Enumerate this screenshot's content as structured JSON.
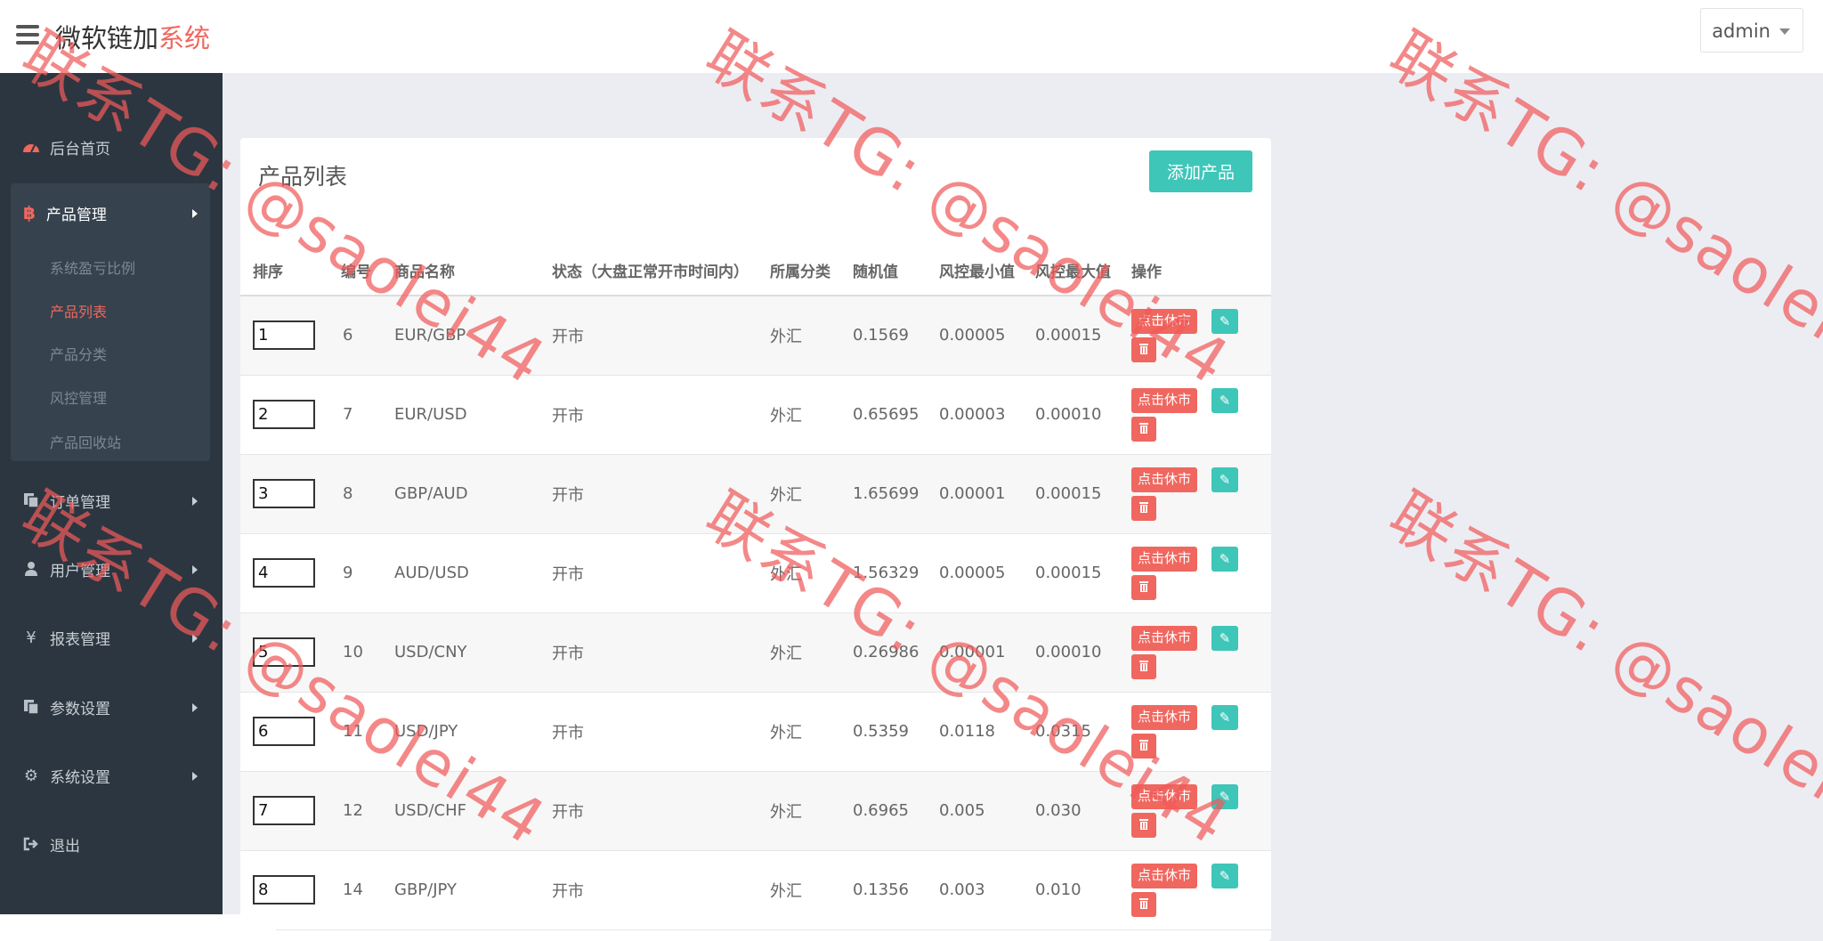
{
  "app": {
    "brand_main": "微软链加",
    "brand_accent": "系统",
    "user": "admin"
  },
  "sidebar": {
    "dashboard": "后台首页",
    "product_group": {
      "label": "产品管理",
      "items": [
        "系统盈亏比例",
        "产品列表",
        "产品分类",
        "风控管理",
        "产品回收站"
      ],
      "active_index": 1
    },
    "items": [
      {
        "label": "订单管理",
        "icon": "copy-icon"
      },
      {
        "label": "用户管理",
        "icon": "user-icon"
      },
      {
        "label": "报表管理",
        "icon": "yen-icon"
      },
      {
        "label": "参数设置",
        "icon": "copy-icon"
      },
      {
        "label": "系统设置",
        "icon": "cogs-icon"
      }
    ],
    "logout": "退出"
  },
  "panel": {
    "title": "产品列表",
    "add_button": "添加产品",
    "columns": [
      "排序",
      "编号",
      "商品名称",
      "状态（大盘正常开市时间内）",
      "所属分类",
      "随机值",
      "风控最小值",
      "风控最大值",
      "操作"
    ],
    "rows": [
      {
        "sort": "1",
        "id": "6",
        "name": "EUR/GBP",
        "status": "开市",
        "category": "外汇",
        "random": "0.1569",
        "min": "0.00005",
        "max": "0.00015"
      },
      {
        "sort": "2",
        "id": "7",
        "name": "EUR/USD",
        "status": "开市",
        "category": "外汇",
        "random": "0.65695",
        "min": "0.00003",
        "max": "0.00010"
      },
      {
        "sort": "3",
        "id": "8",
        "name": "GBP/AUD",
        "status": "开市",
        "category": "外汇",
        "random": "1.65699",
        "min": "0.00001",
        "max": "0.00015"
      },
      {
        "sort": "4",
        "id": "9",
        "name": "AUD/USD",
        "status": "开市",
        "category": "外汇",
        "random": "1.56329",
        "min": "0.00005",
        "max": "0.00015"
      },
      {
        "sort": "5",
        "id": "10",
        "name": "USD/CNY",
        "status": "开市",
        "category": "外汇",
        "random": "0.26986",
        "min": "0.00001",
        "max": "0.00010"
      },
      {
        "sort": "6",
        "id": "11",
        "name": "USD/JPY",
        "status": "开市",
        "category": "外汇",
        "random": "0.5359",
        "min": "0.0118",
        "max": "0.0315"
      },
      {
        "sort": "7",
        "id": "12",
        "name": "USD/CHF",
        "status": "开市",
        "category": "外汇",
        "random": "0.6965",
        "min": "0.005",
        "max": "0.030"
      },
      {
        "sort": "8",
        "id": "14",
        "name": "GBP/JPY",
        "status": "开市",
        "category": "外汇",
        "random": "0.1356",
        "min": "0.003",
        "max": "0.010"
      }
    ],
    "pause_button": "点击休市"
  },
  "watermark": "联系TG: @saolei44",
  "colors": {
    "accent": "#f0675f",
    "teal": "#3ec6b9",
    "sidebar": "#2b3640"
  }
}
